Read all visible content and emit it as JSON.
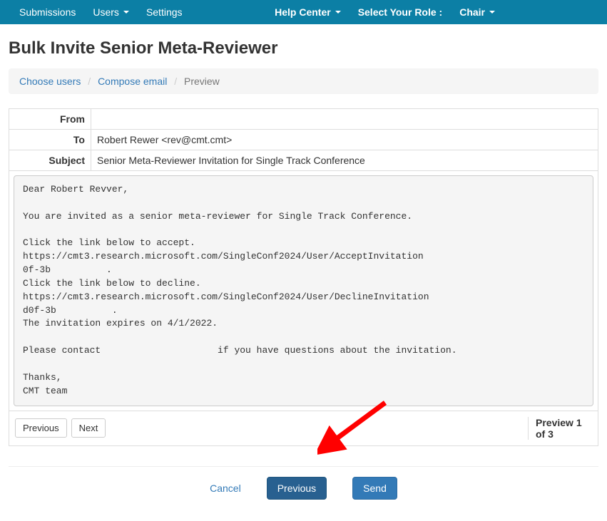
{
  "navbar": {
    "submissions": "Submissions",
    "users": "Users",
    "settings": "Settings",
    "help_center": "Help Center",
    "select_role": "Select Your Role :",
    "chair": "Chair"
  },
  "page_title": "Bulk Invite Senior Meta-Reviewer",
  "breadcrumb": {
    "choose_users": "Choose users",
    "compose_email": "Compose email",
    "preview": "Preview"
  },
  "email_header": {
    "from_label": "From",
    "from_value": "",
    "to_label": "To",
    "to_value": "Robert Rewer <rev@cmt.cmt>",
    "subject_label": "Subject",
    "subject_value": "Senior Meta-Reviewer Invitation for Single Track Conference"
  },
  "email_body": "Dear Robert Revver,\n\nYou are invited as a senior meta-reviewer for Single Track Conference.\n\nClick the link below to accept.\nhttps://cmt3.research.microsoft.com/SingleConf2024/User/AcceptInvitation\n0f-3b          .\nClick the link below to decline.\nhttps://cmt3.research.microsoft.com/SingleConf2024/User/DeclineInvitation\nd0f-3b          .\nThe invitation expires on 4/1/2022.\n\nPlease contact                     if you have questions about the invitation.\n\nThanks,\nCMT team",
  "nav_buttons": {
    "previous": "Previous",
    "next": "Next"
  },
  "preview_count": "Preview 1 of 3",
  "footer": {
    "cancel": "Cancel",
    "previous": "Previous",
    "send": "Send"
  }
}
